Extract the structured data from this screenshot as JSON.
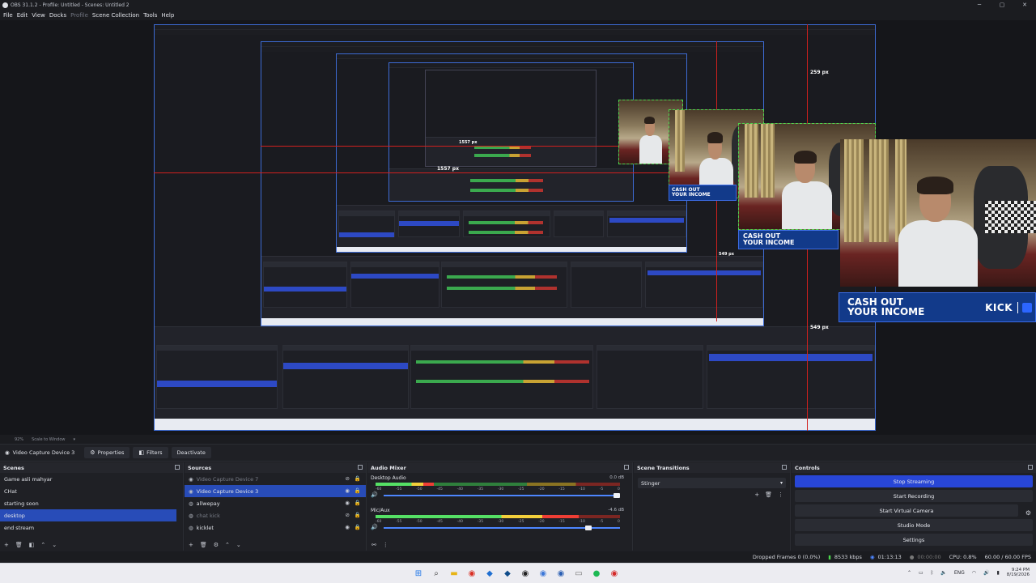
{
  "window": {
    "title": "OBS 31.1.2 - Profile: Untitled - Scenes: Untitled 2",
    "controls": [
      "─",
      "▢",
      "✕"
    ]
  },
  "menu": [
    "File",
    "Edit",
    "View",
    "Docks",
    "Profile",
    "Scene Collection",
    "Tools",
    "Help"
  ],
  "preview": {
    "measure_labels": [
      "259 px",
      "549 px",
      "549 px",
      "1557 px",
      "1557 px"
    ],
    "overlay": {
      "cash_line1": "CASH OUT",
      "cash_line2": "YOUR INCOME",
      "kick": "KICK"
    }
  },
  "scale_bar": {
    "zoom": "92%",
    "scale_mode": "Scale to Window"
  },
  "source_toolbar": {
    "current_source": "Video Capture Device 3",
    "properties": "Properties",
    "filters": "Filters",
    "deactivate": "Deactivate"
  },
  "scenes": {
    "title": "Scenes",
    "items": [
      "Game asli mahyar",
      "CHat",
      "starting soon",
      "desktop",
      "end stream"
    ],
    "selected": "desktop"
  },
  "sources": {
    "title": "Sources",
    "items": [
      "Video Capture Device 7",
      "Video Capture Device 3",
      "allwepay",
      "chat kick",
      "kicklet"
    ]
  },
  "audio_mixer": {
    "title": "Audio Mixer",
    "ticks": [
      "-60",
      "-55",
      "-50",
      "-45",
      "-40",
      "-35",
      "-30",
      "-25",
      "-20",
      "-15",
      "-10",
      "-5",
      "0"
    ],
    "channels": [
      {
        "name": "Desktop Audio",
        "db": "0.0 dB",
        "level": 0.24,
        "fader": 1.0
      },
      {
        "name": "Mic/Aux",
        "db": "-4.6 dB",
        "level": 0.83,
        "fader": 0.88
      }
    ]
  },
  "scene_transitions": {
    "title": "Scene Transitions",
    "selected": "Stinger"
  },
  "controls": {
    "title": "Controls",
    "stop_streaming": "Stop Streaming",
    "start_recording": "Start Recording",
    "start_virtual_camera": "Start Virtual Camera",
    "studio_mode": "Studio Mode",
    "settings": "Settings"
  },
  "status": {
    "dropped_frames": "Dropped Frames 0 (0.0%)",
    "bitrate": "8533 kbps",
    "stream_time": "01:13:13",
    "rec_time": "00:00:00",
    "cpu": "CPU: 0.8%",
    "fps": "60.00 / 60.00 FPS"
  },
  "tray": {
    "lang": "ENG",
    "time": "9:24 PM",
    "date": "8/19/2026"
  },
  "colors": {
    "accent": "#284cb8",
    "stop_streaming": "#2846d6",
    "guide_red": "#d1201e"
  }
}
